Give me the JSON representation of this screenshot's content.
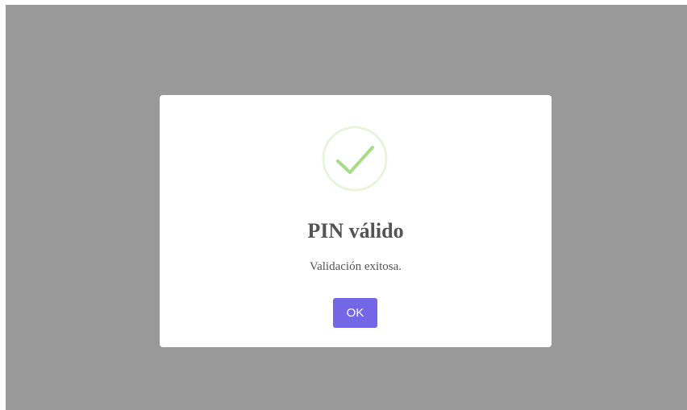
{
  "dialog": {
    "icon": "success-check-icon",
    "title": "PIN válido",
    "message": "Validación exitosa.",
    "confirm_label": "OK"
  },
  "colors": {
    "overlay": "#999999",
    "dialog_background": "#ffffff",
    "check": "#a5dc86",
    "check_ring": "#e6f5dc",
    "title_text": "#545454",
    "button": "#7367e8",
    "button_text": "#ffffff"
  }
}
